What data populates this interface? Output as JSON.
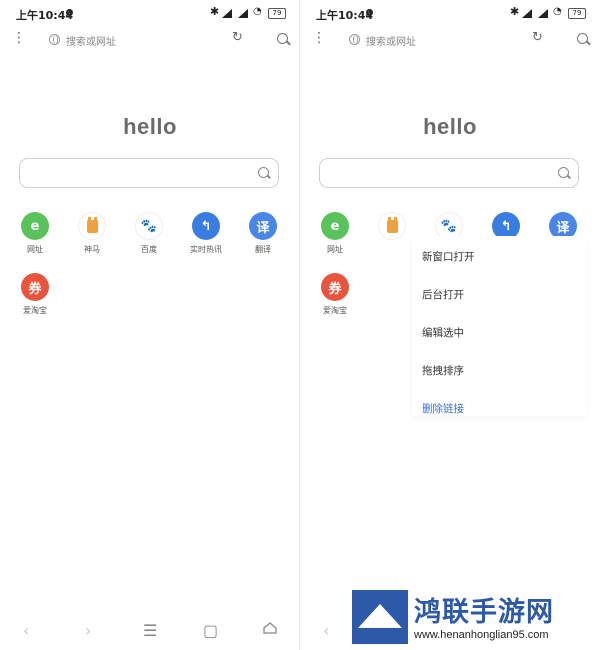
{
  "status_bar": {
    "time": "上午10:44",
    "battery": "79"
  },
  "url_bar": {
    "placeholder": "搜索或网址"
  },
  "home": {
    "greeting": "hello"
  },
  "shortcuts": [
    {
      "label": "网址",
      "glyph": "e",
      "color": "#5ac25a"
    },
    {
      "label": "神马",
      "glyph": "",
      "color": "#f0a03c"
    },
    {
      "label": "百度",
      "glyph": "🐾",
      "color": "#2b6de0"
    },
    {
      "label": "实时热讯",
      "glyph": "↰",
      "color": "#3a7de0"
    },
    {
      "label": "翻译",
      "glyph": "译",
      "color": "#4a86e8"
    },
    {
      "label": "爱淘宝",
      "glyph": "券",
      "color": "#e9543d"
    },
    {
      "label": "",
      "glyph": "+",
      "color": "#cccccc"
    }
  ],
  "right_visible_shortcut_labels": {
    "hotnews_partial": "讯"
  },
  "context_menu": {
    "items": [
      "新窗口打开",
      "后台打开",
      "编辑选中",
      "拖拽排序",
      "删除链接"
    ]
  },
  "watermark": {
    "title": "鸿联手游网",
    "url": "www.henanhonglian95.com"
  },
  "icons": [
    "menu-icon",
    "globe-icon",
    "refresh-icon",
    "search-icon",
    "back-icon",
    "forward-icon",
    "tabs-icon",
    "windows-icon",
    "home-icon"
  ]
}
